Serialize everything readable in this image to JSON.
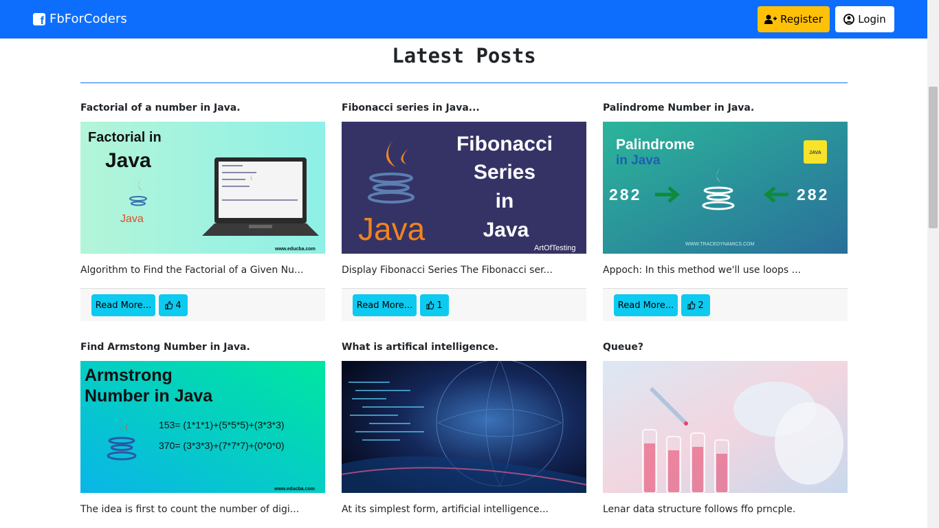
{
  "nav": {
    "brand": "FbForCoders",
    "register": "Register",
    "login": "Login"
  },
  "heading": "Latest Posts",
  "posts": [
    {
      "title": "Factorial of a number in Java.",
      "excerpt": "Algorithm to Find the Factorial of a Given Nu...",
      "read": "Read More...",
      "likes": "4",
      "img": {
        "line1": "Factorial in",
        "line2": "Java",
        "logo": "Java",
        "credit": "www.educba.com"
      }
    },
    {
      "title": "Fibonacci series in Java...",
      "excerpt": "Display Fibonacci Series The Fibonacci ser...",
      "read": "Read More...",
      "likes": "1",
      "img": {
        "line1": "Fibonacci",
        "line2": "Series",
        "line3": "in",
        "line4": "Java",
        "logo": "Java",
        "credit": "ArtOfTesting"
      }
    },
    {
      "title": "Palindrome Number in Java.",
      "excerpt": "Appoch: In this method we'll use loops ...",
      "read": "Read More...",
      "likes": "2",
      "img": {
        "line1": "Palindrome",
        "line2": "in Java",
        "num": "282",
        "badge": "JAVA",
        "credit": "WWW.TRACEDYNAMICS.COM"
      }
    },
    {
      "title": "Find Armstong Number in Java.",
      "excerpt": "The idea is first to count the number of digi...",
      "img": {
        "line1": "Armstrong",
        "line2": "Number in Java",
        "eq1": "153= (1*1*1)+(5*5*5)+(3*3*3)",
        "eq2": "370= (3*3*3)+(7*7*7)+(0*0*0)",
        "credit": "www.educba.com"
      }
    },
    {
      "title": "What is artifical intelligence.",
      "excerpt": "At its simplest form, artificial intelligence..."
    },
    {
      "title": "Queue?",
      "excerpt": "Lenar data structure follows ffo prncple."
    }
  ]
}
